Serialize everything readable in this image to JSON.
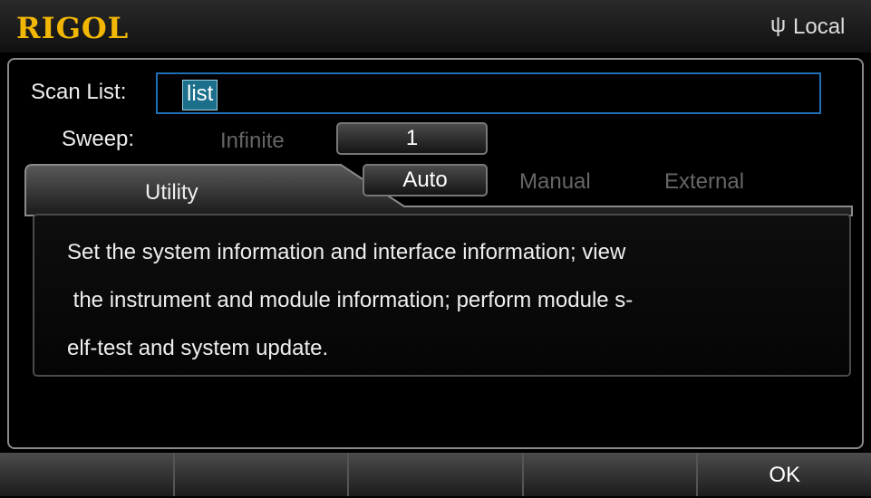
{
  "header": {
    "brand": "RIGOL",
    "usb_icon": "usb-icon",
    "mode": "Local"
  },
  "scan": {
    "label": "Scan List:",
    "value": "list"
  },
  "sweep": {
    "label": "Sweep:",
    "option_infinite": "Infinite",
    "count": "1"
  },
  "tab": {
    "label": "Utility"
  },
  "trigger": {
    "options": [
      "Auto",
      "Manual",
      "External"
    ],
    "selected": "Auto"
  },
  "description": {
    "lines": [
      "Set the system information and interface information; view",
      " the instrument and module information; perform module s-",
      "elf-test and system update."
    ]
  },
  "softkeys": [
    "",
    "",
    "",
    "",
    "OK"
  ],
  "colors": {
    "brand": "#f2b705",
    "focus_border": "#1f6fb5",
    "chip": "#1b6f8a"
  }
}
